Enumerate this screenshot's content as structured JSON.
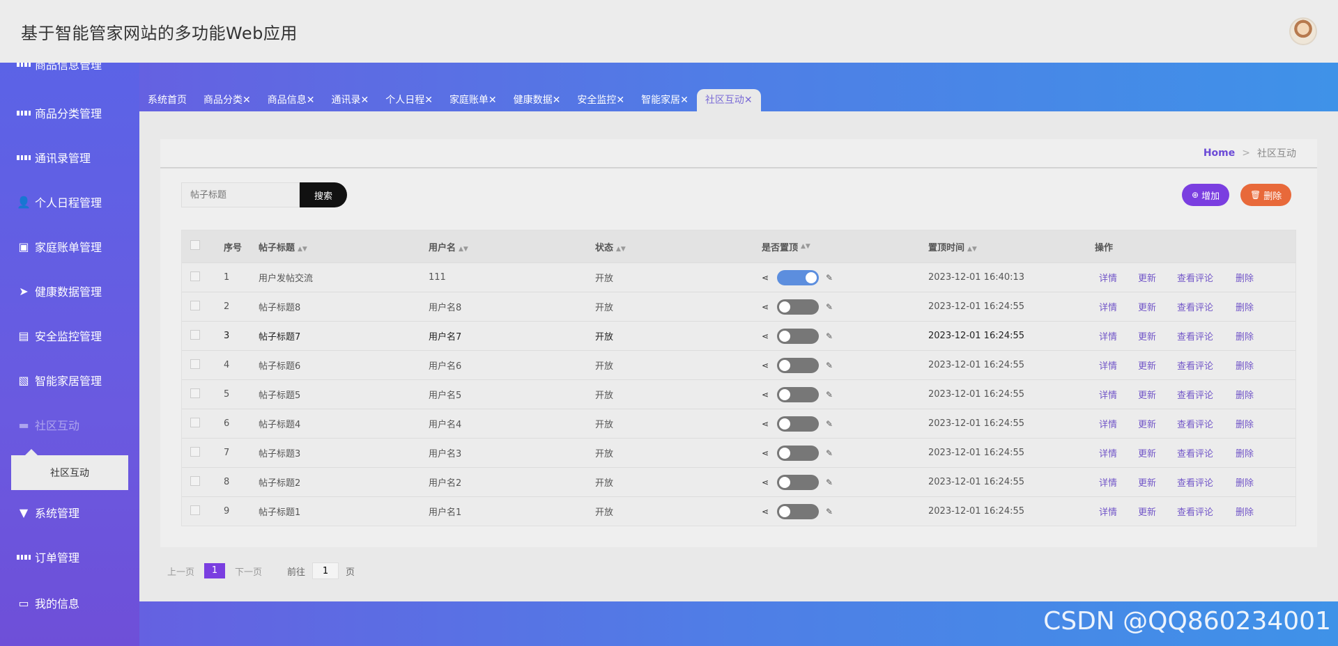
{
  "header": {
    "title": "基于智能管家网站的多功能Web应用"
  },
  "sidebar": {
    "items": [
      {
        "label": "商品信息管理",
        "icon": "grid-icon"
      },
      {
        "label": "商品分类管理",
        "icon": "grid-icon"
      },
      {
        "label": "通讯录管理",
        "icon": "grid-icon"
      },
      {
        "label": "个人日程管理",
        "icon": "user-icon"
      },
      {
        "label": "家庭账单管理",
        "icon": "briefcase-icon"
      },
      {
        "label": "健康数据管理",
        "icon": "paper-plane-icon"
      },
      {
        "label": "安全监控管理",
        "icon": "clipboard-icon"
      },
      {
        "label": "智能家居管理",
        "icon": "excel-icon"
      },
      {
        "label": "社区互动",
        "icon": "monitor-icon"
      },
      {
        "label": "系统管理",
        "icon": "funnel-icon"
      },
      {
        "label": "订单管理",
        "icon": "grid-icon"
      },
      {
        "label": "我的信息",
        "icon": "card-icon"
      }
    ],
    "submenu": {
      "label": "社区互动"
    }
  },
  "tabs": [
    {
      "label": "系统首页"
    },
    {
      "label": "商品分类✕"
    },
    {
      "label": "商品信息✕"
    },
    {
      "label": "通讯录✕"
    },
    {
      "label": "个人日程✕"
    },
    {
      "label": "家庭账单✕"
    },
    {
      "label": "健康数据✕"
    },
    {
      "label": "安全监控✕"
    },
    {
      "label": "智能家居✕"
    },
    {
      "label": "社区互动✕"
    }
  ],
  "breadcrumb": {
    "home": "Home",
    "separator": ">",
    "current": "社区互动"
  },
  "search": {
    "placeholder": "帖子标题",
    "button": "搜索"
  },
  "actions": {
    "add": "增加",
    "delete": "删除"
  },
  "table": {
    "headers": [
      "序号",
      "帖子标题",
      "用户名",
      "状态",
      "是否置顶",
      "置顶时间",
      "操作"
    ],
    "ops": [
      "详情",
      "更新",
      "查看评论",
      "删除"
    ],
    "rows": [
      {
        "no": "1",
        "title": "用户发帖交流",
        "user": "111",
        "status": "开放",
        "pinned": true,
        "time": "2023-12-01 16:40:13"
      },
      {
        "no": "2",
        "title": "帖子标题8",
        "user": "用户名8",
        "status": "开放",
        "pinned": false,
        "time": "2023-12-01 16:24:55"
      },
      {
        "no": "3",
        "title": "帖子标题7",
        "user": "用户名7",
        "status": "开放",
        "pinned": false,
        "time": "2023-12-01 16:24:55"
      },
      {
        "no": "4",
        "title": "帖子标题6",
        "user": "用户名6",
        "status": "开放",
        "pinned": false,
        "time": "2023-12-01 16:24:55"
      },
      {
        "no": "5",
        "title": "帖子标题5",
        "user": "用户名5",
        "status": "开放",
        "pinned": false,
        "time": "2023-12-01 16:24:55"
      },
      {
        "no": "6",
        "title": "帖子标题4",
        "user": "用户名4",
        "status": "开放",
        "pinned": false,
        "time": "2023-12-01 16:24:55"
      },
      {
        "no": "7",
        "title": "帖子标题3",
        "user": "用户名3",
        "status": "开放",
        "pinned": false,
        "time": "2023-12-01 16:24:55"
      },
      {
        "no": "8",
        "title": "帖子标题2",
        "user": "用户名2",
        "status": "开放",
        "pinned": false,
        "time": "2023-12-01 16:24:55"
      },
      {
        "no": "9",
        "title": "帖子标题1",
        "user": "用户名1",
        "status": "开放",
        "pinned": false,
        "time": "2023-12-01 16:24:55"
      }
    ]
  },
  "pagination": {
    "prev": "上一页",
    "current": "1",
    "next": "下一页",
    "goto": "前往",
    "page_value": "1",
    "page_unit": "页"
  },
  "watermark": "CSDN @QQ860234001",
  "colors": {
    "accent": "#7a3ee0",
    "delete": "#e8693a",
    "link": "#7256c8",
    "switch_on": "#5c8ede"
  }
}
